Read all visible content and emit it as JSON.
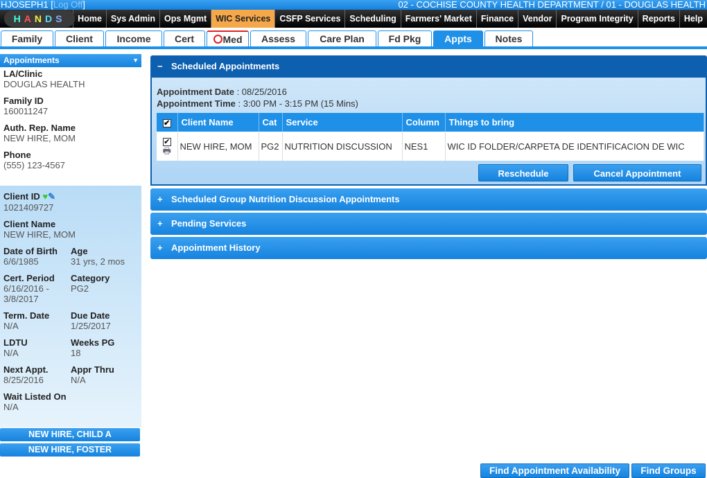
{
  "header": {
    "user": "HJOSEPH1",
    "logoff": "Log Off",
    "department": "02 - COCHISE COUNTY HEALTH DEPARTMENT / 01 - DOUGLAS HEALTH",
    "logo": "HANDS"
  },
  "nav": [
    "Home",
    "Sys Admin",
    "Ops Mgmt",
    "WIC Services",
    "CSFP Services",
    "Scheduling",
    "Farmers' Market",
    "Finance",
    "Vendor",
    "Program Integrity",
    "Reports",
    "Help"
  ],
  "tabs": [
    "Family",
    "Client",
    "Income",
    "Cert",
    "Med",
    "Assess",
    "Care Plan",
    "Fd Pkg",
    "Appts",
    "Notes"
  ],
  "sidebar": {
    "title": "Appointments",
    "la_label": "LA/Clinic",
    "la": "DOUGLAS HEALTH",
    "family_label": "Family ID",
    "family": "160011247",
    "auth_label": "Auth. Rep. Name",
    "auth": "NEW HIRE, MOM",
    "phone_label": "Phone",
    "phone": "(555) 123-4567",
    "cid_label": "Client ID",
    "cid": "1021409727",
    "cname_label": "Client Name",
    "cname": "NEW HIRE, MOM",
    "dob_label": "Date of Birth",
    "dob": "6/6/1985",
    "age_label": "Age",
    "age": "31 yrs, 2 mos",
    "cert_label": "Cert. Period",
    "cert": "6/16/2016 - 3/8/2017",
    "cat_label": "Category",
    "cat": "PG2",
    "term_label": "Term. Date",
    "term": "N/A",
    "due_label": "Due Date",
    "due": "1/25/2017",
    "ldtu_label": "LDTU",
    "ldtu": "N/A",
    "weeks_label": "Weeks PG",
    "weeks": "18",
    "next_label": "Next Appt.",
    "next": "8/25/2016",
    "appr_label": "Appr Thru",
    "appr": "N/A",
    "wait_label": "Wait Listed On",
    "wait": "N/A",
    "family_members": [
      "NEW HIRE, CHILD A",
      "NEW HIRE, FOSTER"
    ]
  },
  "scheduled": {
    "title": "Scheduled Appointments",
    "sign": "−",
    "date_label": "Appointment Date",
    "date": "08/25/2016",
    "time_label": "Appointment Time",
    "time": "3:00 PM - 3:15 PM (15 Mins)",
    "columns": [
      "Client Name",
      "Cat",
      "Service",
      "Column",
      "Things to bring"
    ],
    "rows": [
      {
        "client": "NEW HIRE, MOM",
        "cat": "PG2",
        "service": "NUTRITION DISCUSSION",
        "column": "NES1",
        "bring": "WIC ID FOLDER/CARPETA DE IDENTIFICACION DE WIC"
      }
    ],
    "reschedule": "Reschedule",
    "cancel": "Cancel Appointment"
  },
  "sections": [
    "Scheduled Group Nutrition Discussion Appointments",
    "Pending Services",
    "Appointment History"
  ],
  "plus": "+",
  "bottom": {
    "find_avail": "Find Appointment Availability",
    "find_groups": "Find Groups"
  }
}
